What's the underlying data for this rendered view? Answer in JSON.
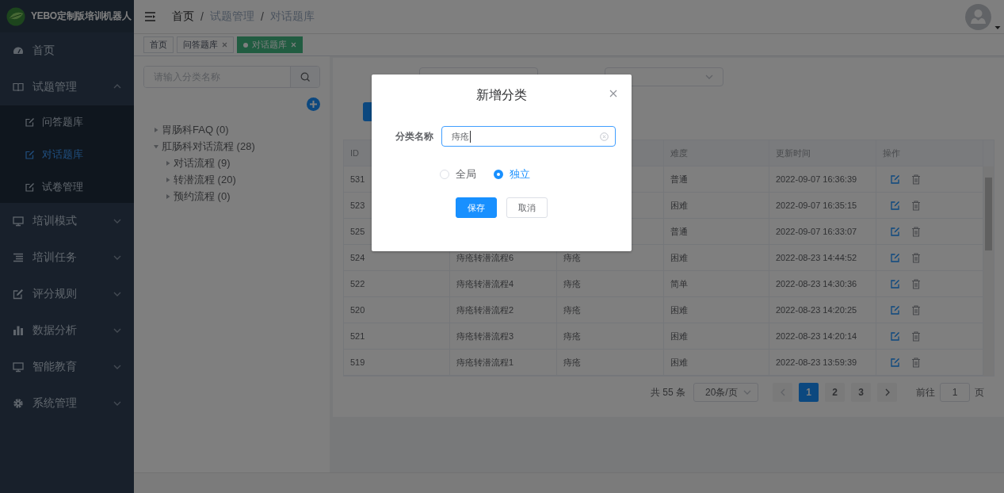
{
  "logo": {
    "title": "YEBO定制版培训机器人"
  },
  "sidebar": {
    "items": [
      {
        "label": "首页",
        "has_children": false
      },
      {
        "label": "试题管理",
        "expanded": true,
        "has_children": true,
        "children": [
          {
            "label": "问答题库",
            "selected": false
          },
          {
            "label": "对话题库",
            "selected": true
          },
          {
            "label": "试卷管理",
            "selected": false
          }
        ]
      },
      {
        "label": "培训模式",
        "expanded": false,
        "has_children": true
      },
      {
        "label": "培训任务",
        "expanded": false,
        "has_children": true
      },
      {
        "label": "评分规则",
        "expanded": false,
        "has_children": true
      },
      {
        "label": "数据分析",
        "expanded": false,
        "has_children": true
      },
      {
        "label": "智能教育",
        "expanded": false,
        "has_children": true
      },
      {
        "label": "系统管理",
        "expanded": false,
        "has_children": true
      }
    ]
  },
  "breadcrumb": {
    "separator": "/",
    "items": [
      "首页",
      "试题管理",
      "对话题库"
    ]
  },
  "tabs": [
    {
      "label": "首页",
      "closable": false,
      "selected": false
    },
    {
      "label": "问答题库",
      "closable": true,
      "selected": false
    },
    {
      "label": "对话题库",
      "closable": true,
      "selected": true
    }
  ],
  "category_panel": {
    "search": {
      "placeholder": "请输入分类名称"
    },
    "tree": [
      {
        "label": "胃肠科FAQ (0)",
        "expanded": false
      },
      {
        "label": "肛肠科对话流程 (28)",
        "expanded": true,
        "children": [
          {
            "label": "对话流程 (9)",
            "expanded": false
          },
          {
            "label": "转潜流程 (20)",
            "expanded": false
          },
          {
            "label": "预约流程 (0)",
            "expanded": false
          }
        ]
      }
    ]
  },
  "filters": [
    {
      "kind": "input"
    },
    {
      "kind": "select"
    }
  ],
  "table": {
    "columns": [
      "ID",
      "难度",
      "更新时间",
      "操作"
    ],
    "rows": [
      {
        "id": "531",
        "difficulty": "普通",
        "updated": "2022-09-07 16:36:39"
      },
      {
        "id": "523",
        "difficulty": "困难",
        "updated": "2022-09-07 16:35:15"
      },
      {
        "id": "525",
        "difficulty": "普通",
        "updated": "2022-09-07 16:33:07"
      },
      {
        "id": "524",
        "column_2": "痔疮转潜流程6",
        "column_3": "痔疮",
        "difficulty": "困难",
        "updated": "2022-08-23 14:44:52"
      },
      {
        "id": "522",
        "column_2": "痔疮转潜流程4",
        "column_3": "痔疮",
        "difficulty": "简单",
        "updated": "2022-08-23 14:30:36"
      },
      {
        "id": "520",
        "column_2": "痔疮转潜流程2",
        "column_3": "痔疮",
        "difficulty": "困难",
        "updated": "2022-08-23 14:20:25"
      },
      {
        "id": "521",
        "column_2": "痔疮转潜流程3",
        "column_3": "痔疮",
        "difficulty": "困难",
        "updated": "2022-08-23 14:20:14"
      },
      {
        "id": "519",
        "column_2": "痔疮转潜流程1",
        "column_3": "痔疮",
        "difficulty": "困难",
        "updated": "2022-08-23 13:59:39"
      }
    ]
  },
  "pagination": {
    "total": "共 55 条",
    "page_size": "20条/页",
    "pages": [
      {
        "label": "1",
        "selected": true
      },
      {
        "label": "2",
        "selected": false
      },
      {
        "label": "3",
        "selected": false
      }
    ],
    "goto_label": "前往",
    "goto_value": "1",
    "goto_suffix": "页"
  },
  "dialog": {
    "title": "新增分类",
    "field_label": "分类名称",
    "field_value": "痔疮",
    "options": [
      {
        "label": "全局",
        "selected": false
      },
      {
        "label": "独立",
        "selected": true
      }
    ],
    "buttons": [
      {
        "label": "保存",
        "kind": "primary"
      },
      {
        "label": "取消",
        "kind": "default"
      }
    ]
  }
}
